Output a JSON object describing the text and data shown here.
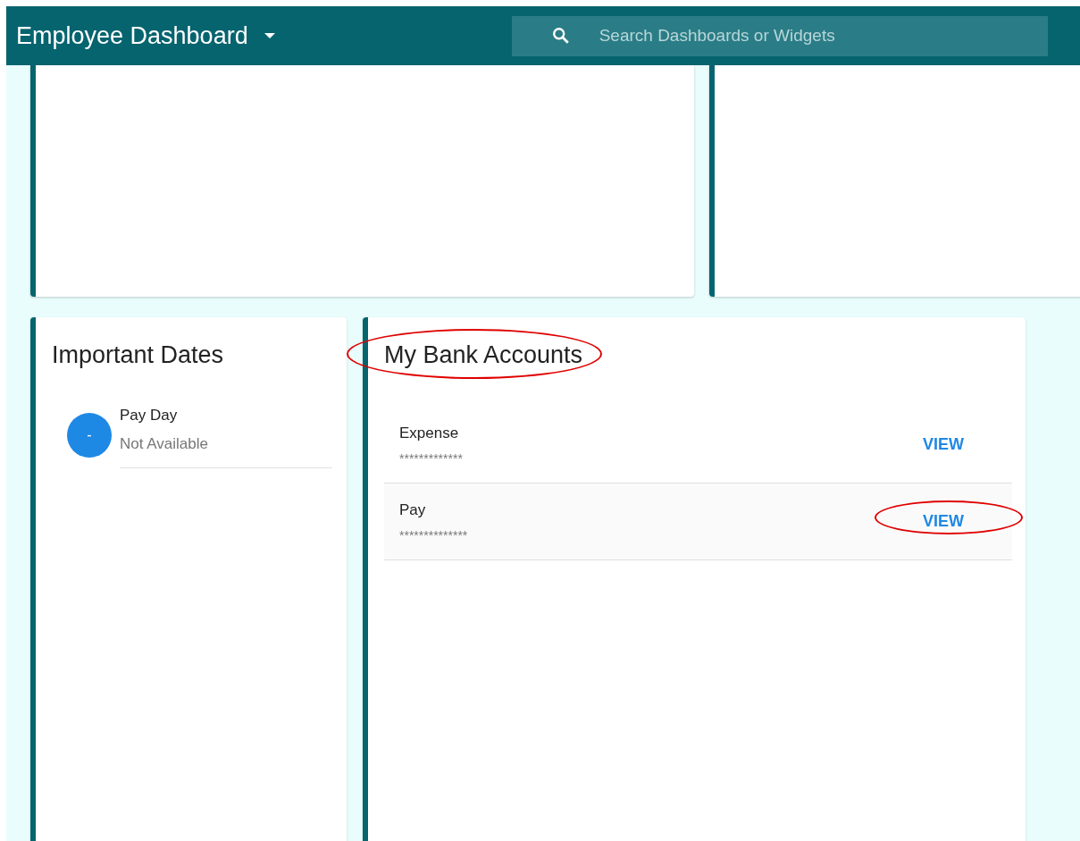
{
  "header": {
    "title": "Employee Dashboard",
    "search": {
      "placeholder": "Search Dashboards or Widgets"
    }
  },
  "important_dates": {
    "title": "Important Dates",
    "items": [
      {
        "avatar": "-",
        "title": "Pay Day",
        "value": "Not Available"
      }
    ]
  },
  "bank_accounts": {
    "title": "My Bank Accounts",
    "title_circled": true,
    "rows": [
      {
        "name": "Expense",
        "number": "*************",
        "action": "VIEW",
        "highlighted": false,
        "circled": false
      },
      {
        "name": "Pay",
        "number": "**************",
        "action": "VIEW",
        "highlighted": true,
        "circled": true
      }
    ]
  }
}
